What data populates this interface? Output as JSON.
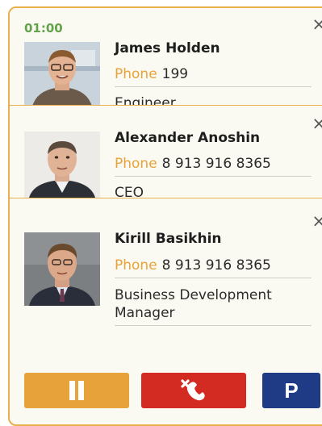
{
  "timer": "01:00",
  "contacts": [
    {
      "name": "James Holden",
      "phone_label": "Phone",
      "phone": "199",
      "role": "Engineer",
      "close_icon": "×"
    },
    {
      "name": "Alexander Anoshin",
      "phone_label": "Phone",
      "phone": "8 913 916 8365",
      "role": "CEO",
      "close_icon": "×"
    },
    {
      "name": "Kirill Basikhin",
      "phone_label": "Phone",
      "phone": "8 913 916 8365",
      "role": "Business Development Manager",
      "close_icon": "×"
    }
  ],
  "controls": {
    "park_label": "P",
    "hold_icon": "pause-icon",
    "hangup_icon": "hangup-phone-icon"
  },
  "colors": {
    "accent": "#e8a23a",
    "border": "#e8b04a",
    "timer": "#63a34a",
    "hangup": "#d32a22",
    "park": "#1f3b85"
  }
}
